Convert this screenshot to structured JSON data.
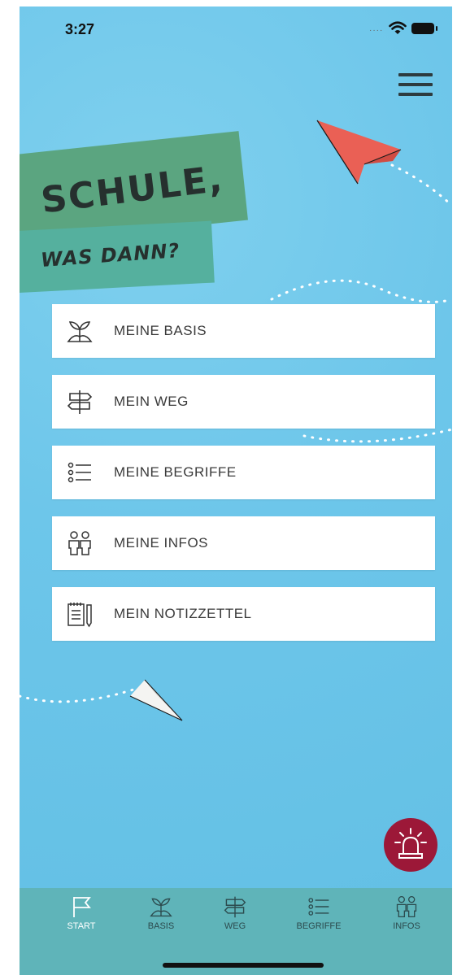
{
  "status_bar": {
    "time": "3:27"
  },
  "header": {
    "menu_icon": "hamburger-menu-icon"
  },
  "hero": {
    "title": "SCHULE,",
    "subtitle": "WAS DANN?"
  },
  "menu": {
    "items": [
      {
        "label": "MEINE BASIS",
        "icon": "sprout-icon"
      },
      {
        "label": "MEIN WEG",
        "icon": "signpost-icon"
      },
      {
        "label": "MEINE BEGRIFFE",
        "icon": "list-icon"
      },
      {
        "label": "MEINE INFOS",
        "icon": "people-icon"
      },
      {
        "label": "MEIN NOTIZZETTEL",
        "icon": "notepad-pencil-icon"
      }
    ]
  },
  "alarm_button": {
    "icon": "alarm-siren-icon",
    "color": "#9c1838"
  },
  "tabbar": {
    "tabs": [
      {
        "label": "START",
        "icon": "flag-icon",
        "active": true
      },
      {
        "label": "BASIS",
        "icon": "sprout-icon",
        "active": false
      },
      {
        "label": "WEG",
        "icon": "signpost-icon",
        "active": false
      },
      {
        "label": "BEGRIFFE",
        "icon": "list-icon",
        "active": false
      },
      {
        "label": "INFOS",
        "icon": "people-icon",
        "active": false
      }
    ]
  },
  "colors": {
    "background": "#6dc6ea",
    "title_card": "#5ba580",
    "subtitle_card": "#55b09e",
    "tabbar": "#5fb4b9",
    "plane_red": "#ea6055",
    "alarm": "#9c1838"
  }
}
